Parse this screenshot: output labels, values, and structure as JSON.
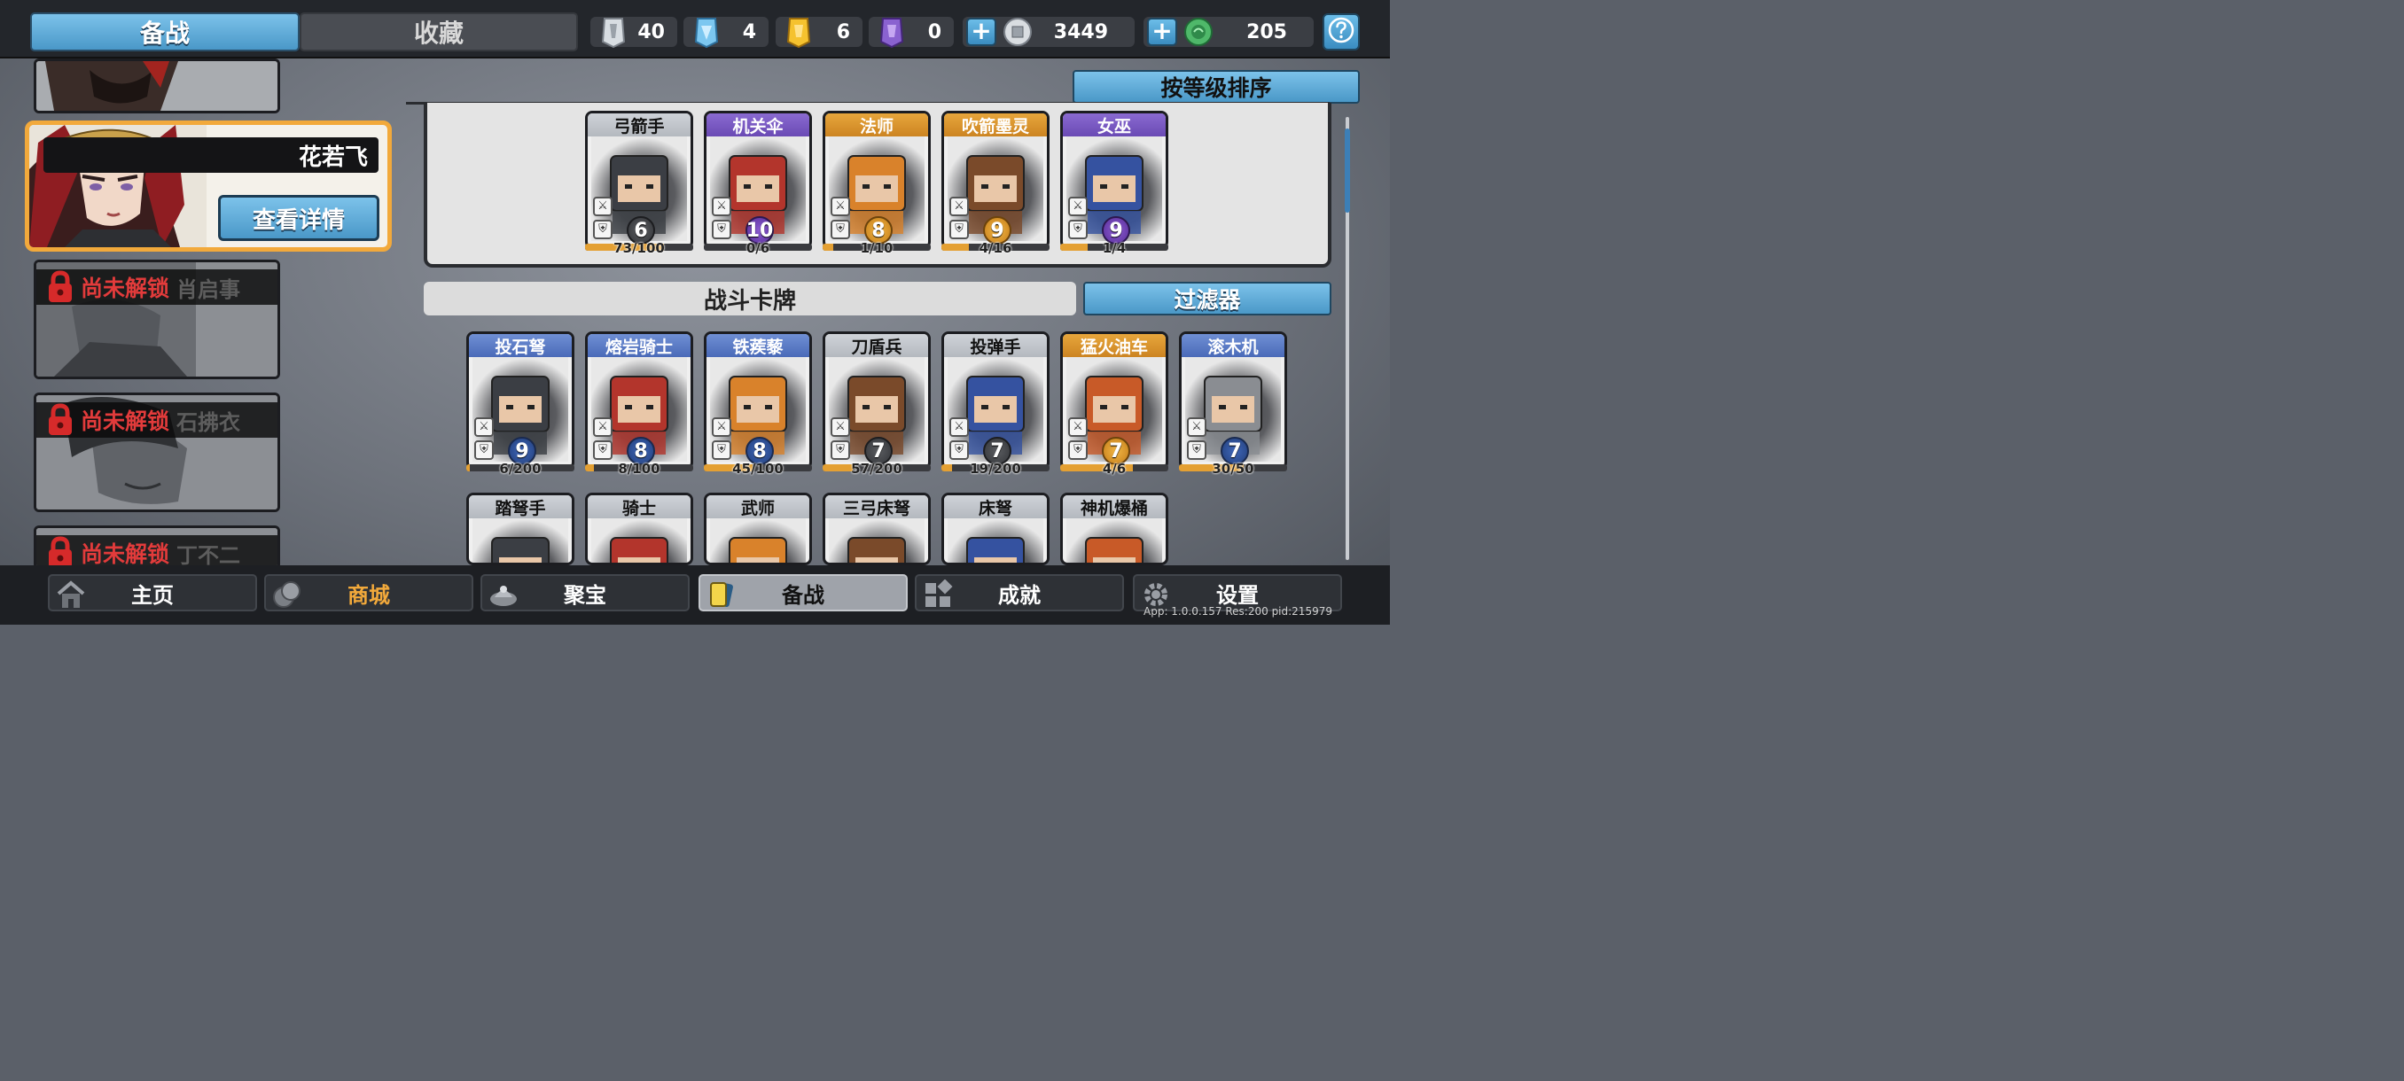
{
  "header": {
    "tabs": [
      {
        "label": "备战",
        "active": true
      },
      {
        "label": "收藏",
        "active": false
      }
    ],
    "resources": [
      {
        "icon": "silver-seal-icon",
        "value": "40"
      },
      {
        "icon": "blue-crystal-icon",
        "value": "4"
      },
      {
        "icon": "gold-badge-icon",
        "value": "6"
      },
      {
        "icon": "purple-badge-icon",
        "value": "0"
      },
      {
        "icon": "silver-coin-icon",
        "value": "3449",
        "has_plus": true
      },
      {
        "icon": "jade-coin-icon",
        "value": "205",
        "has_plus": true
      }
    ],
    "help_icon": "question-icon"
  },
  "heroes": {
    "selected": {
      "name": "花若飞",
      "detail_button": "查看详情"
    },
    "locked_label": "尚未解锁",
    "locked": [
      {
        "name": "肖启事"
      },
      {
        "name": "石拂衣"
      },
      {
        "name": "丁不二"
      }
    ]
  },
  "deck": {
    "sort_button": "按等级排序",
    "cards": [
      {
        "name": "弓箭手",
        "rarity": "common",
        "level": "6",
        "progress_text": "73/100",
        "progress": 0.73
      },
      {
        "name": "机关伞",
        "rarity": "epic",
        "level": "10",
        "progress_text": "0/6",
        "progress": 0.0
      },
      {
        "name": "法师",
        "rarity": "legend",
        "level": "8",
        "progress_text": "1/10",
        "progress": 0.1
      },
      {
        "name": "吹箭墨灵",
        "rarity": "legend",
        "level": "9",
        "progress_text": "4/16",
        "progress": 0.25
      },
      {
        "name": "女巫",
        "rarity": "epic",
        "level": "9",
        "progress_text": "1/4",
        "progress": 0.25
      }
    ]
  },
  "battle_cards": {
    "title": "战斗卡牌",
    "filter_button": "过滤器",
    "row1": [
      {
        "name": "投石弩",
        "rarity": "rare",
        "level": "9",
        "progress_text": "6/200",
        "progress": 0.03
      },
      {
        "name": "熔岩骑士",
        "rarity": "rare",
        "level": "8",
        "progress_text": "8/100",
        "progress": 0.08
      },
      {
        "name": "铁蒺藜",
        "rarity": "rare",
        "level": "8",
        "progress_text": "45/100",
        "progress": 0.45
      },
      {
        "name": "刀盾兵",
        "rarity": "common",
        "level": "7",
        "progress_text": "57/200",
        "progress": 0.285
      },
      {
        "name": "投弹手",
        "rarity": "common",
        "level": "7",
        "progress_text": "19/200",
        "progress": 0.095
      },
      {
        "name": "猛火油车",
        "rarity": "legend",
        "level": "7",
        "progress_text": "4/6",
        "progress": 0.67
      },
      {
        "name": "滚木机",
        "rarity": "rare",
        "level": "7",
        "progress_text": "30/50",
        "progress": 0.6
      }
    ],
    "row2": [
      {
        "name": "踏弩手",
        "rarity": "common"
      },
      {
        "name": "骑士",
        "rarity": "common"
      },
      {
        "name": "武师",
        "rarity": "common"
      },
      {
        "name": "三弓床弩",
        "rarity": "common"
      },
      {
        "name": "床弩",
        "rarity": "common"
      },
      {
        "name": "神机爆桶",
        "rarity": "common"
      }
    ]
  },
  "nav": [
    {
      "label": "主页",
      "icon": "home-icon"
    },
    {
      "label": "商城",
      "icon": "shop-icon"
    },
    {
      "label": "聚宝",
      "icon": "treasure-icon"
    },
    {
      "label": "备战",
      "icon": "card-icon",
      "active": true
    },
    {
      "label": "成就",
      "icon": "achievement-icon"
    },
    {
      "label": "设置",
      "icon": "gear-icon"
    }
  ],
  "footer": {
    "app_info": "App: 1.0.0.157 Res:200 pid:215979"
  },
  "colors": {
    "accent_blue": "#4a98c8",
    "gold": "#f2a93b",
    "locked_red": "#e23b3b"
  }
}
